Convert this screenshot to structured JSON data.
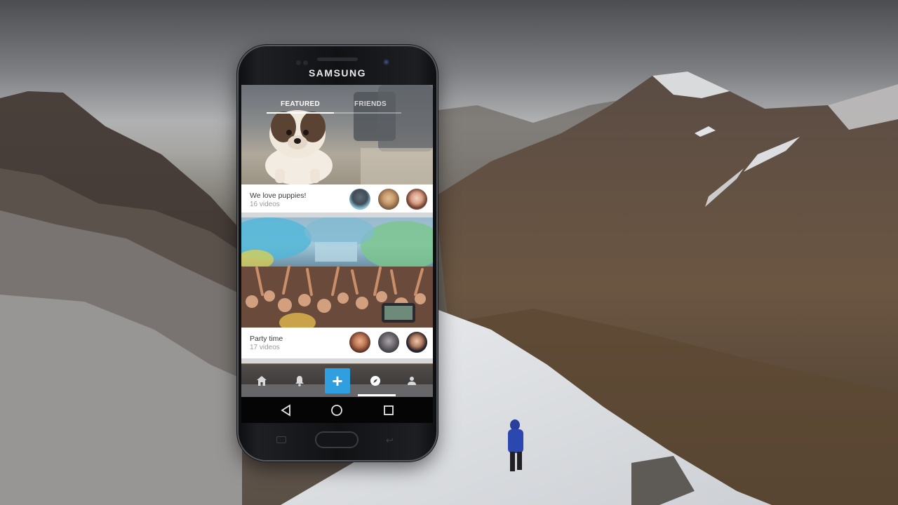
{
  "device": {
    "brand": "SAMSUNG"
  },
  "app": {
    "tabs": [
      {
        "label": "FEATURED",
        "active": true
      },
      {
        "label": "FRIENDS",
        "active": false
      }
    ],
    "cards": [
      {
        "title": "We love puppies!",
        "count": "16 videos"
      },
      {
        "title": "Party time",
        "count": "17 videos"
      }
    ],
    "bottom_nav": {
      "items": [
        "home-icon",
        "bell-icon",
        "add-icon",
        "compass-icon",
        "profile-icon"
      ],
      "active": "compass-icon",
      "add_label": "+"
    }
  },
  "colors": {
    "accent": "#2f9fe0",
    "nav_bar": "#3c3c3e",
    "card_bg": "#ffffff"
  }
}
